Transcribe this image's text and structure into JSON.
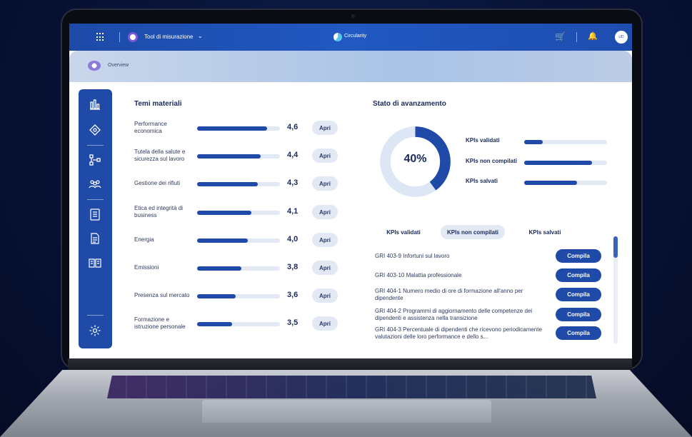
{
  "topbar": {
    "tool_label": "Tool di misurazione",
    "brand": "Circularity",
    "avatar_initials": "UD"
  },
  "breadcrumb": {
    "label": "Overview"
  },
  "temi": {
    "title": "Temi materiali",
    "button_label": "Apri",
    "items": [
      {
        "label": "Performance economica",
        "value": "4,6",
        "score": 4.6
      },
      {
        "label": "Tutela della salute e sicurezza sul lavoro",
        "value": "4,4",
        "score": 4.4
      },
      {
        "label": "Gestione dei rifiuti",
        "value": "4,3",
        "score": 4.3
      },
      {
        "label": "Etica ed integrità di business",
        "value": "4,1",
        "score": 4.1
      },
      {
        "label": "Energia",
        "value": "4,0",
        "score": 4.0
      },
      {
        "label": "Emissioni",
        "value": "3,8",
        "score": 3.8
      },
      {
        "label": "Presenza sul mercato",
        "value": "3,6",
        "score": 3.6
      },
      {
        "label": "Formazione e istruzione personale",
        "value": "3,5",
        "score": 3.5
      }
    ]
  },
  "stato": {
    "title": "Stato di avanzamento",
    "percent_label": "40%",
    "percent": 0.4,
    "kpis": [
      {
        "label": "KPIs validati",
        "fill": 0.22
      },
      {
        "label": "KPIs non compilati",
        "fill": 0.82
      },
      {
        "label": "KPIs salvati",
        "fill": 0.64
      }
    ]
  },
  "tabs": [
    {
      "label": "KPIs validati",
      "active": false
    },
    {
      "label": "KPIs non compilati",
      "active": true
    },
    {
      "label": "KPIs salvati",
      "active": false
    }
  ],
  "gri": {
    "button_label": "Compila",
    "items": [
      "GRI 403-9 Infortuni sul lavoro",
      "GRI 403-10 Malattia professionale",
      "GRI 404-1 Numero medio di ore di formazione all'anno per dipendente",
      "GRI 404-2 Programmi di aggiornamento delle competenze dei dipendenti e assistenza nella transizione",
      "GRI 404-3 Percentuale di dipendenti che ricevono periodicamente valutazioni delle loro performance e dello s..."
    ]
  },
  "colors": {
    "primary": "#1f4aa8",
    "track": "#e3e9f4",
    "text_dark": "#1a2b5a"
  }
}
